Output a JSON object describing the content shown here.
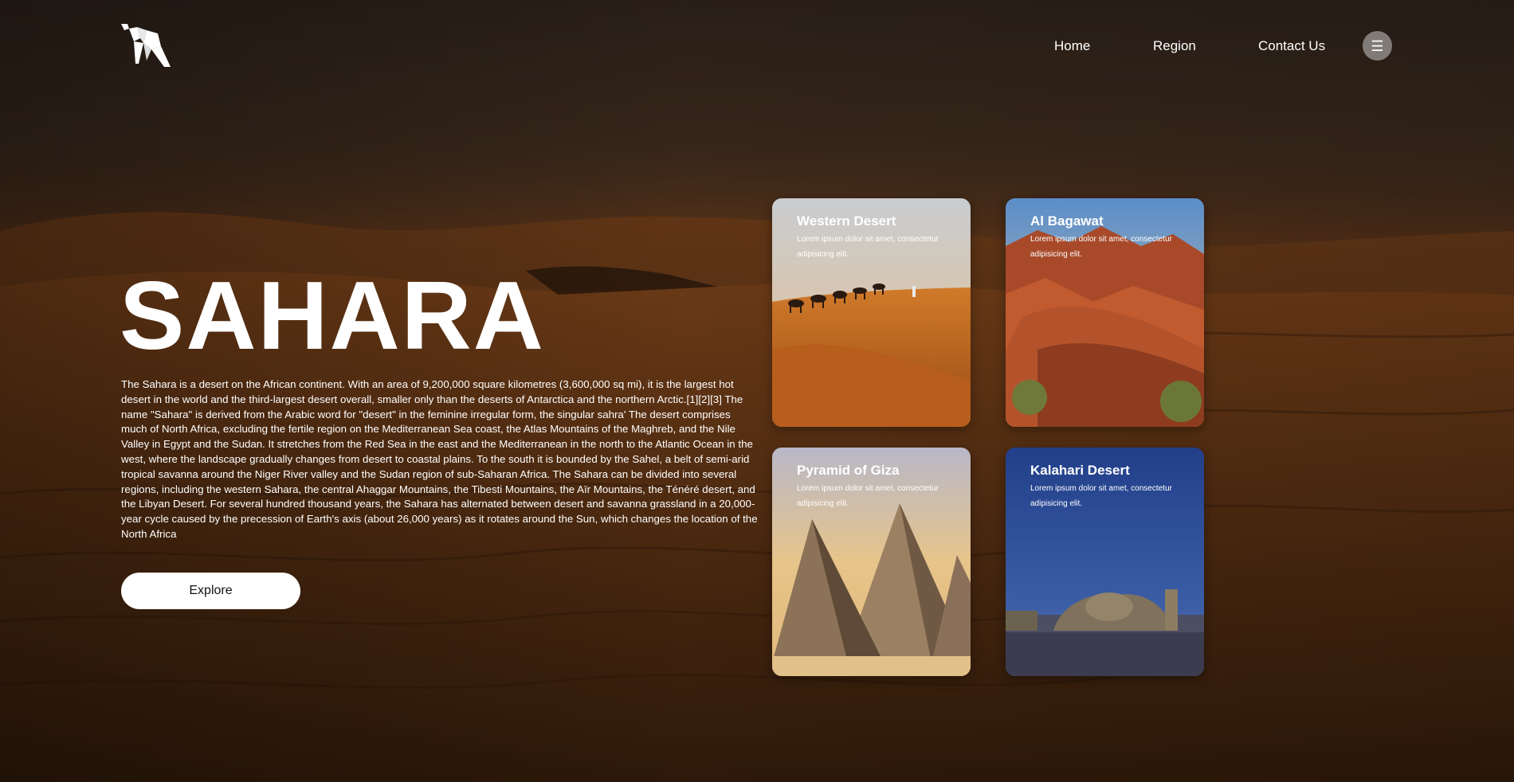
{
  "brand": {
    "logo_icon": "origami-camel-logo-icon"
  },
  "nav": {
    "items": [
      {
        "label": "Home"
      },
      {
        "label": "Region"
      },
      {
        "label": "Contact Us"
      }
    ],
    "menu_icon": "☰"
  },
  "hero": {
    "title": "SAHARA",
    "description": "The Sahara is a desert on the African continent. With an area of 9,200,000 square kilometres (3,600,000 sq mi), it is the largest hot desert in the world and the third-largest desert overall, smaller only than the deserts of Antarctica and the northern Arctic.[1][2][3] The name \"Sahara\" is derived from the Arabic word for \"desert\" in the feminine irregular form, the singular sahra' The desert comprises much of North Africa, excluding the fertile region on the Mediterranean Sea coast, the Atlas Mountains of the Maghreb, and the Nile Valley in Egypt and the Sudan. It stretches from the Red Sea in the east and the Mediterranean in the north to the Atlantic Ocean in the west, where the landscape gradually changes from desert to coastal plains. To the south it is bounded by the Sahel, a belt of semi-arid tropical savanna around the Niger River valley and the Sudan region of sub-Saharan Africa. The Sahara can be divided into several regions, including the western Sahara, the central Ahaggar Mountains, the Tibesti Mountains, the Aïr Mountains, the Ténéré desert, and the Libyan Desert. For several hundred thousand years, the Sahara has alternated between desert and savanna grassland in a 20,000-year cycle caused by the precession of Earth's axis (about 26,000 years) as it rotates around the Sun, which changes the location of the North Africa",
    "button_label": "Explore"
  },
  "cards": [
    {
      "title": "Western Desert",
      "text": "Lorem ipsum dolor sit amet, consectetur adipisicing elit.",
      "image": "camel-caravan-dunes"
    },
    {
      "title": "Al Bagawat",
      "text": "Lorem ipsum dolor sit amet, consectetur adipisicing elit.",
      "image": "red-rock-canyon"
    },
    {
      "title": "Pyramid of Giza",
      "text": "Lorem ipsum dolor sit amet, consectetur adipisicing elit.",
      "image": "giza-pyramids"
    },
    {
      "title": "Kalahari Desert",
      "text": "Lorem ipsum dolor sit amet, consectetur adipisicing elit.",
      "image": "domed-ruins-night-sky"
    }
  ]
}
